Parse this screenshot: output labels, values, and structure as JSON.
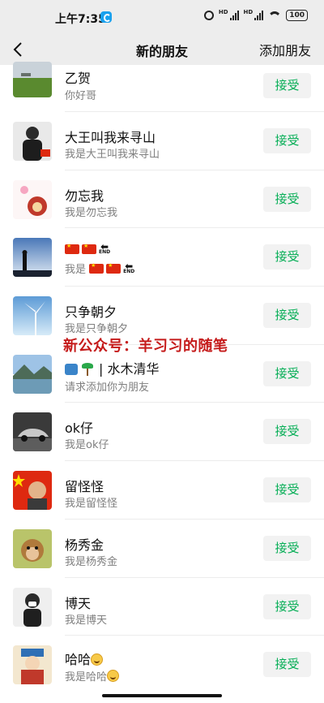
{
  "status_bar": {
    "time": "上午7:35",
    "battery": "100",
    "network_labels": [
      "HD",
      "HD"
    ]
  },
  "header": {
    "title": "新的朋友",
    "add_friend": "添加朋友"
  },
  "watermark": "新公众号：羊习习的随笔",
  "items": [
    {
      "name": "乙贺",
      "message": "你好哥",
      "button": "接受",
      "avatar": "grass-field-photo"
    },
    {
      "name": "大王叫我来寻山",
      "message": "我是大王叫我来寻山",
      "button": "接受",
      "avatar": "man-in-suit-photo"
    },
    {
      "name": "勿忘我",
      "message": "我是勿忘我",
      "button": "接受",
      "avatar": "cartoon-lion-illustration"
    },
    {
      "name": "",
      "message": "我是",
      "button": "接受",
      "avatar": "silhouette-sunset-photo",
      "name_icons": [
        "china-flag-icon",
        "china-flag-icon",
        "end-arrow-icon"
      ],
      "message_icons": [
        "china-flag-icon",
        "china-flag-icon",
        "end-arrow-icon"
      ],
      "end_text": "END"
    },
    {
      "name": "只争朝夕",
      "message": "我是只争朝夕",
      "button": "接受",
      "avatar": "wind-turbine-photo"
    },
    {
      "name": "| 水木清华",
      "message": "请求添加你为朋友",
      "button": "接受",
      "avatar": "lake-mountain-photo",
      "name_icons": [
        "wave-icon",
        "palm-tree-icon"
      ]
    },
    {
      "name": "ok仔",
      "message": "我是ok仔",
      "button": "接受",
      "avatar": "sports-car-photo"
    },
    {
      "name": "留怪怪",
      "message": "我是留怪怪",
      "button": "接受",
      "avatar": "portrait-with-flag-photo"
    },
    {
      "name": "杨秀金",
      "message": "我是杨秀金",
      "button": "接受",
      "avatar": "monkey-photo"
    },
    {
      "name": "博天",
      "message": "我是博天",
      "button": "接受",
      "avatar": "person-with-mask-photo"
    },
    {
      "name": "哈哈",
      "message": "我是哈哈",
      "button": "接受",
      "avatar": "opera-figure-illustration",
      "name_icons": [
        "smiling-face-icon"
      ],
      "message_icons": [
        "smiling-face-icon"
      ]
    }
  ],
  "colors": {
    "accent": "#06ae56",
    "header_bg": "#ededed",
    "button_bg": "#f2f2f2",
    "watermark": "#c51b1b"
  }
}
